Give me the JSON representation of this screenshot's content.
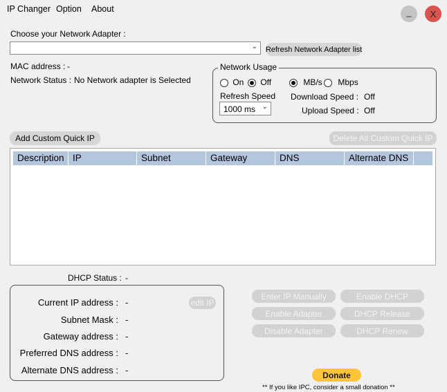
{
  "menu": {
    "items": [
      "IP Changer",
      "Option",
      "About"
    ]
  },
  "window": {
    "minimize_label": "_",
    "close_label": "X",
    "close_color": "#d9534f",
    "minimize_color": "#c4c4c4"
  },
  "adapter": {
    "choose_label": "Choose your Network Adapter :",
    "selected": "",
    "refresh_button": "Refresh Network Adapter list",
    "mac_label": "MAC address :",
    "mac_value": "-",
    "status_label": "Network Status :",
    "status_value": "No Network adapter is Selected"
  },
  "network_usage": {
    "title": "Network Usage",
    "on_label": "On",
    "off_label": "Off",
    "mode": "off",
    "unit_mbs_label": "MB/s",
    "unit_mbps_label": "Mbps",
    "unit": "MB/s",
    "refresh_speed_label": "Refresh Speed",
    "refresh_speed_value": "1000 ms",
    "download_label": "Download Speed :",
    "download_value": "Off",
    "upload_label": "Upload Speed :",
    "upload_value": "Off"
  },
  "quick_ip": {
    "add_button": "Add Custom Quick IP",
    "delete_all_button": "Delete All Custom Quick IP",
    "columns": [
      "Description",
      "IP",
      "Subnet",
      "Gateway",
      "DNS",
      "Alternate DNS"
    ],
    "rows": []
  },
  "dhcp": {
    "status_label": "DHCP Status :",
    "status_value": "-"
  },
  "info": {
    "current_ip_label": "Current IP address :",
    "current_ip_value": "-",
    "edit_ip_button": "edit IP",
    "subnet_label": "Subnet Mask :",
    "subnet_value": "-",
    "gateway_label": "Gateway address :",
    "gateway_value": "-",
    "pref_dns_label": "Preferred DNS address :",
    "pref_dns_value": "-",
    "alt_dns_label": "Alternate DNS address :",
    "alt_dns_value": "-"
  },
  "actions": {
    "enter_ip_manually": "Enter IP Manually",
    "enable_dhcp": "Enable DHCP",
    "enable_adapter": "Enable Adapter",
    "dhcp_release": "DHCP Release",
    "disable_adapter": "Disable Adapter",
    "dhcp_renew": "DHCP Renew"
  },
  "donate": {
    "button": "Donate",
    "note": "** If you like IPC, consider a small donation **",
    "color": "#ffc439"
  }
}
